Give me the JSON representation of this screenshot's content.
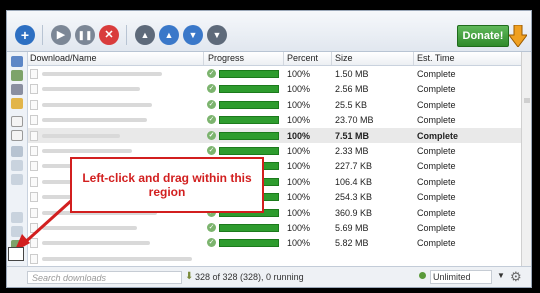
{
  "toolbar": {
    "buttons": [
      "add-icon",
      "play-icon",
      "pause-icon",
      "stop-icon",
      "move-top-icon",
      "move-up-icon",
      "move-down-icon",
      "move-bottom-icon"
    ],
    "donate_label": "Donate!"
  },
  "columns": {
    "name": "Download/Name",
    "progress": "Progress",
    "percent": "Percent",
    "size": "Size",
    "eta": "Est. Time"
  },
  "rows": [
    {
      "percent": "100%",
      "size": "1.50 MB",
      "eta": "Complete",
      "selected": false
    },
    {
      "percent": "100%",
      "size": "2.56 MB",
      "eta": "Complete",
      "selected": false
    },
    {
      "percent": "100%",
      "size": "25.5 KB",
      "eta": "Complete",
      "selected": false
    },
    {
      "percent": "100%",
      "size": "23.70 MB",
      "eta": "Complete",
      "selected": false
    },
    {
      "percent": "100%",
      "size": "7.51 MB",
      "eta": "Complete",
      "selected": true
    },
    {
      "percent": "100%",
      "size": "2.33 MB",
      "eta": "Complete",
      "selected": false
    },
    {
      "percent": "100%",
      "size": "227.7 KB",
      "eta": "Complete",
      "selected": false
    },
    {
      "percent": "100%",
      "size": "106.4 KB",
      "eta": "Complete",
      "selected": false
    },
    {
      "percent": "100%",
      "size": "254.3 KB",
      "eta": "Complete",
      "selected": false
    },
    {
      "percent": "100%",
      "size": "360.9 KB",
      "eta": "Complete",
      "selected": false
    },
    {
      "percent": "100%",
      "size": "5.69 MB",
      "eta": "Complete",
      "selected": false
    },
    {
      "percent": "100%",
      "size": "5.82 MB",
      "eta": "Complete",
      "selected": false
    },
    {
      "percent": "",
      "size": "",
      "eta": "",
      "selected": false
    }
  ],
  "status": {
    "search_placeholder": "Search downloads",
    "summary": "328 of 328 (328), 0 running",
    "speed_limit": "Unlimited"
  },
  "callout": {
    "text": "Left-click and drag within this region"
  },
  "colors": {
    "progress": "#2e9c2e",
    "callout": "#d21f1f",
    "donate": "#3a9a35"
  }
}
